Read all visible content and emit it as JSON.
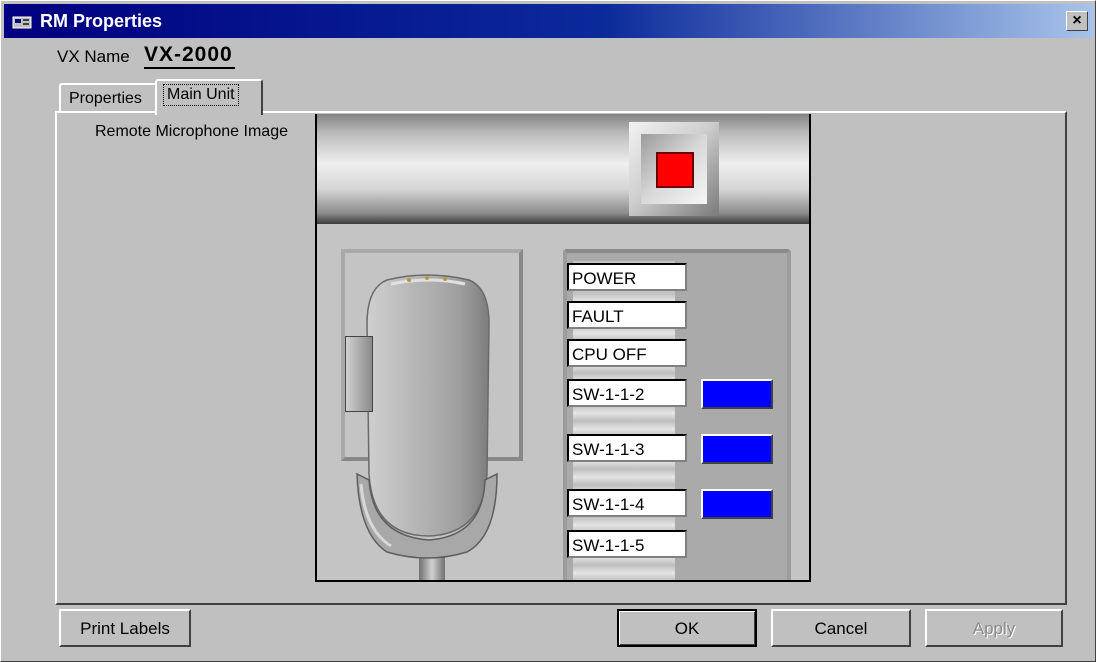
{
  "window": {
    "title": "RM Properties",
    "close_label": "×"
  },
  "vx": {
    "label": "VX Name",
    "value": "VX-2000"
  },
  "tabs": [
    {
      "label": "Properties",
      "active": false
    },
    {
      "label": "Main Unit",
      "active": true
    }
  ],
  "main": {
    "image_label": "Remote Microphone Image",
    "indicator_color": "#ff0000",
    "led_color": "#0000ff",
    "labels": [
      {
        "text": "POWER",
        "led": false
      },
      {
        "text": "FAULT",
        "led": false
      },
      {
        "text": "CPU OFF",
        "led": false
      },
      {
        "text": "SW-1-1-2",
        "led": true
      },
      {
        "text": "SW-1-1-3",
        "led": true
      },
      {
        "text": "SW-1-1-4",
        "led": true
      },
      {
        "text": "SW-1-1-5",
        "led": false
      }
    ]
  },
  "buttons": {
    "print_labels": "Print Labels",
    "ok": "OK",
    "cancel": "Cancel",
    "apply": "Apply"
  }
}
